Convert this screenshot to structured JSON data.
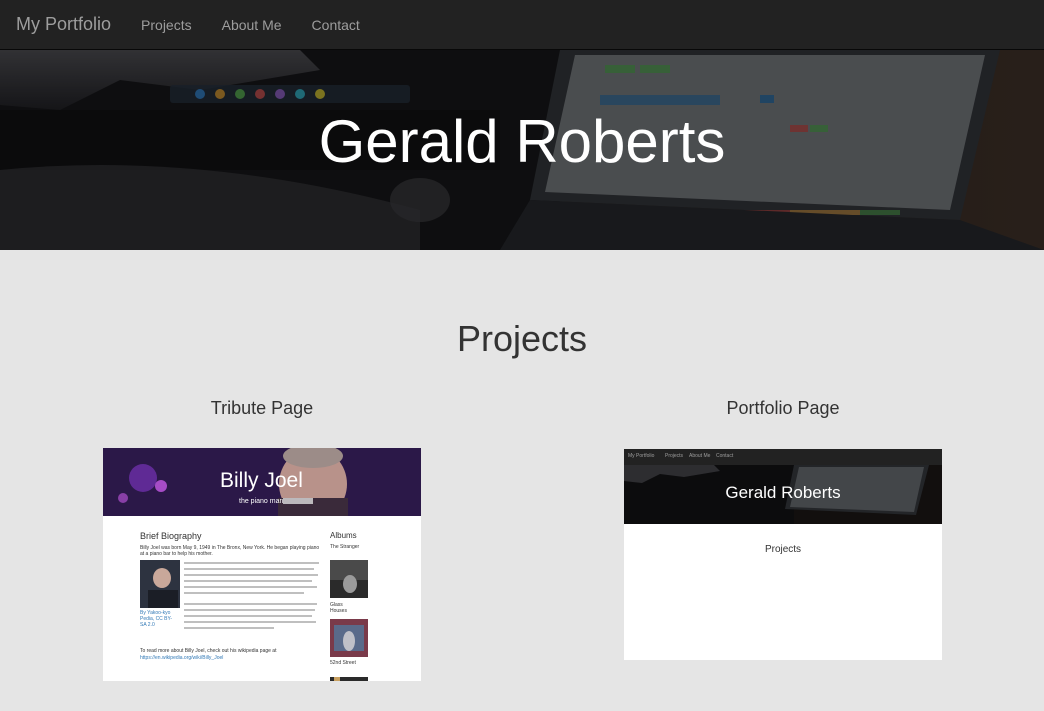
{
  "navbar": {
    "brand": "My Portfolio",
    "links": [
      "Projects",
      "About Me",
      "Contact"
    ]
  },
  "hero": {
    "title": "Gerald Roberts"
  },
  "projects": {
    "heading": "Projects",
    "items": [
      {
        "title": "Tribute Page",
        "thumbnail": {
          "name": "Billy Joel",
          "subtitle": "the piano man",
          "bio_heading": "Brief Biography",
          "albums_heading": "Albums",
          "albums": [
            "The Stranger",
            "Glass Houses",
            "52nd Street"
          ],
          "bio_text": "Billy Joel was born May 9, 1949 in The Bronx, New York. He began playing piano at a piano bar to help his mother.",
          "caption": "By Yakoo-kyo Pedia, CC BY-SA 2.0",
          "more_text": "To read more about Billy Joel, check out his wikipedia page at",
          "more_link": "https://en.wikipedia.org/wiki/Billy_Joel"
        }
      },
      {
        "title": "Portfolio Page",
        "thumbnail": {
          "brand": "My Portfolio",
          "links": [
            "Projects",
            "About Me",
            "Contact"
          ],
          "title": "Gerald Roberts",
          "section": "Projects"
        }
      }
    ]
  },
  "colors": {
    "navbar_bg": "#222222",
    "nav_text": "#9d9d9d",
    "page_bg": "#e5e5e5",
    "heading_text": "#333333"
  }
}
